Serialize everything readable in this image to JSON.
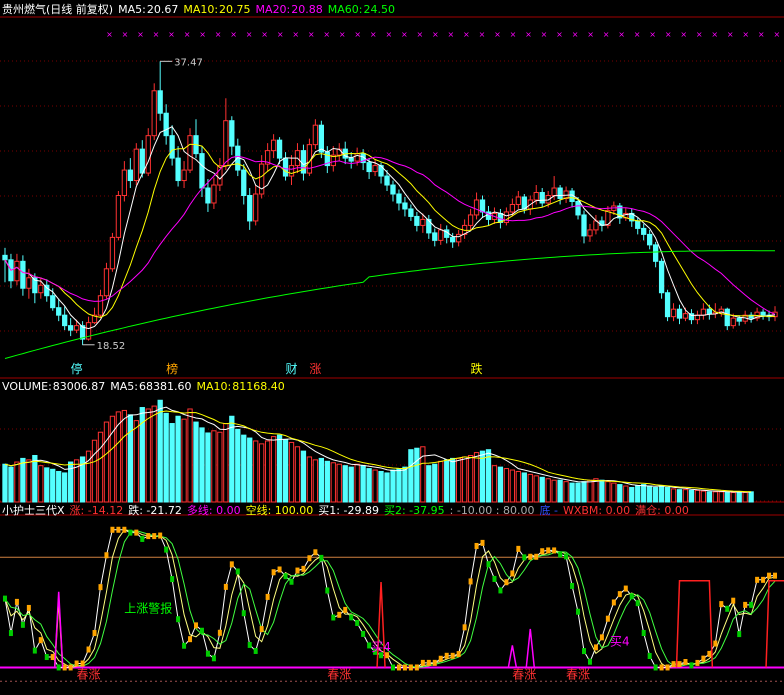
{
  "colors": {
    "bg": "#000000",
    "up": "#ff3232",
    "down": "#54ffff",
    "grid": "#7a0000",
    "ma5": "#ffffff",
    "ma10": "#ffff00",
    "ma20": "#ff00ff",
    "ma60": "#00ff00",
    "sep": "#a00000",
    "orange": "#ffa500",
    "green": "#00cc00",
    "red": "#ff2020",
    "magenta": "#ff00ff",
    "blue": "#3050ff"
  },
  "price_panel": {
    "title": "贵州燃气(日线 前复权)",
    "ma5": {
      "label": "MA5:",
      "value": "20.67"
    },
    "ma10": {
      "label": "MA10:",
      "value": "20.75"
    },
    "ma20": {
      "label": "MA20:",
      "value": "20.88"
    },
    "ma60": {
      "label": "MA60:",
      "value": "24.50"
    },
    "high_label": "37.47",
    "low_label": "18.52",
    "markers": [
      {
        "text": "停",
        "color": "#54ffff"
      },
      {
        "text": "榜",
        "color": "#ffa500"
      },
      {
        "text": "财",
        "color": "#54ffff"
      },
      {
        "text": "涨",
        "color": "#ff3232"
      },
      {
        "text": "跌",
        "color": "#ffff00"
      }
    ]
  },
  "volume_panel": {
    "volume": {
      "label": "VOLUME:",
      "value": "83006.87"
    },
    "ma5": {
      "label": "MA5:",
      "value": "68381.60"
    },
    "ma10": {
      "label": "MA10:",
      "value": "81168.40"
    }
  },
  "indicator_panel": {
    "name": "小护士三代X",
    "items": [
      {
        "label": "涨:",
        "value": "-14.12",
        "color": "#ff3232"
      },
      {
        "label": "跌:",
        "value": "-21.72",
        "color": "#ffffff"
      },
      {
        "label": "多线:",
        "value": "0.00",
        "color": "#ff00ff"
      },
      {
        "label": "空线:",
        "value": "100.00",
        "color": "#ffff00"
      },
      {
        "label": "买1:",
        "value": "-29.89",
        "color": "#ffffff"
      },
      {
        "label": "买2:",
        "value": "-37.95",
        "color": "#00ff00"
      },
      {
        "label": ":",
        "value": "-10.00 : 80.00",
        "color": "#aaaaaa"
      },
      {
        "label": "底",
        "value": "-",
        "color": "#3050ff"
      },
      {
        "label": "WXBM:",
        "value": "0.00",
        "color": "#ff3232"
      },
      {
        "label": "满仓:",
        "value": "0.00",
        "color": "#ff3232"
      }
    ],
    "signals": [
      {
        "text": "春涨",
        "color": "#ff3232"
      },
      {
        "text": "上涨警报",
        "color": "#00ff00"
      },
      {
        "text": "春涨",
        "color": "#ff3232"
      },
      {
        "text": "买4",
        "color": "#ff00ff"
      },
      {
        "text": "春涨",
        "color": "#ff3232"
      },
      {
        "text": "春涨",
        "color": "#ff3232"
      },
      {
        "text": "买4",
        "color": "#ff00ff"
      }
    ]
  },
  "chart_data": {
    "type": "candlestick",
    "price_ylim": [
      16.5,
      40.5
    ],
    "candles": [
      [
        24.5,
        24.2,
        25.0,
        22.7
      ],
      [
        24.2,
        22.8,
        24.6,
        22.3
      ],
      [
        22.8,
        24.1,
        24.6,
        22.5
      ],
      [
        24.1,
        22.3,
        24.5,
        21.8
      ],
      [
        22.3,
        23.0,
        23.6,
        21.6
      ],
      [
        23.0,
        22.0,
        23.3,
        21.3
      ],
      [
        22.0,
        22.5,
        23.0,
        21.6
      ],
      [
        22.5,
        21.8,
        22.9,
        21.4
      ],
      [
        21.8,
        21.0,
        22.3,
        20.8
      ],
      [
        21.0,
        20.5,
        21.6,
        20.1
      ],
      [
        20.5,
        19.8,
        21.1,
        19.5
      ],
      [
        19.8,
        19.5,
        20.3,
        19.1
      ],
      [
        19.5,
        19.8,
        20.2,
        19.3
      ],
      [
        19.8,
        18.9,
        20.1,
        18.5
      ],
      [
        18.9,
        20.0,
        20.4,
        18.8
      ],
      [
        20.0,
        20.5,
        21.0,
        19.9
      ],
      [
        20.5,
        21.8,
        22.2,
        20.3
      ],
      [
        21.8,
        23.6,
        24.0,
        21.6
      ],
      [
        23.6,
        25.7,
        26.0,
        23.4
      ],
      [
        25.7,
        28.5,
        28.8,
        25.5
      ],
      [
        28.5,
        30.2,
        30.8,
        28.1
      ],
      [
        30.2,
        29.5,
        31.0,
        29.0
      ],
      [
        29.5,
        31.6,
        32.0,
        29.2
      ],
      [
        31.6,
        30.0,
        32.2,
        29.7
      ],
      [
        30.0,
        32.5,
        33.0,
        29.8
      ],
      [
        32.5,
        35.5,
        36.0,
        32.2
      ],
      [
        35.5,
        34.0,
        37.47,
        33.5
      ],
      [
        34.0,
        32.5,
        34.6,
        31.9
      ],
      [
        32.5,
        31.0,
        33.2,
        30.5
      ],
      [
        31.0,
        29.5,
        31.8,
        29.1
      ],
      [
        29.5,
        30.2,
        30.8,
        29.0
      ],
      [
        30.2,
        32.5,
        33.0,
        30.0
      ],
      [
        32.5,
        31.3,
        33.6,
        31.0
      ],
      [
        31.3,
        29.0,
        31.8,
        28.4
      ],
      [
        29.0,
        28.0,
        29.6,
        27.4
      ],
      [
        28.0,
        29.2,
        29.7,
        27.6
      ],
      [
        29.2,
        30.5,
        31.0,
        28.8
      ],
      [
        30.5,
        33.5,
        35.0,
        30.2
      ],
      [
        33.5,
        31.8,
        33.8,
        31.2
      ],
      [
        31.8,
        30.2,
        32.3,
        29.8
      ],
      [
        30.2,
        28.5,
        30.6,
        27.9
      ],
      [
        28.5,
        26.8,
        29.0,
        26.2
      ],
      [
        26.8,
        28.6,
        29.2,
        26.5
      ],
      [
        28.6,
        30.6,
        31.2,
        28.3
      ],
      [
        30.6,
        31.5,
        32.0,
        30.1
      ],
      [
        31.5,
        32.2,
        32.6,
        31.0
      ],
      [
        32.2,
        31.0,
        32.4,
        30.6
      ],
      [
        31.0,
        29.8,
        31.4,
        29.5
      ],
      [
        29.8,
        30.5,
        31.2,
        29.2
      ],
      [
        30.5,
        31.5,
        32.0,
        30.0
      ],
      [
        31.5,
        30.0,
        31.9,
        29.5
      ],
      [
        30.0,
        31.9,
        32.3,
        29.8
      ],
      [
        31.9,
        33.2,
        33.6,
        31.6
      ],
      [
        33.2,
        31.4,
        33.5,
        31.0
      ],
      [
        31.4,
        30.5,
        31.8,
        30.0
      ],
      [
        30.5,
        31.2,
        31.8,
        30.1
      ],
      [
        31.2,
        31.6,
        32.0,
        30.8
      ],
      [
        31.6,
        31.0,
        32.1,
        30.6
      ],
      [
        31.0,
        30.8,
        31.4,
        30.3
      ],
      [
        30.8,
        31.3,
        31.7,
        30.5
      ],
      [
        31.3,
        30.7,
        31.6,
        30.2
      ],
      [
        30.7,
        30.1,
        31.0,
        29.6
      ],
      [
        30.1,
        30.5,
        30.9,
        29.8
      ],
      [
        30.5,
        29.8,
        30.7,
        29.3
      ],
      [
        29.8,
        29.2,
        30.2,
        28.8
      ],
      [
        29.2,
        28.6,
        29.5,
        28.1
      ],
      [
        28.6,
        28.0,
        28.9,
        27.5
      ],
      [
        28.0,
        27.6,
        28.4,
        27.1
      ],
      [
        27.6,
        27.1,
        27.9,
        26.8
      ],
      [
        27.1,
        26.5,
        27.4,
        26.1
      ],
      [
        26.5,
        26.9,
        27.3,
        26.0
      ],
      [
        26.9,
        26.0,
        27.2,
        25.6
      ],
      [
        26.0,
        25.5,
        26.3,
        25.1
      ],
      [
        25.5,
        26.2,
        26.6,
        25.2
      ],
      [
        26.2,
        25.7,
        26.5,
        25.3
      ],
      [
        25.7,
        25.4,
        26.0,
        25.0
      ],
      [
        25.4,
        25.9,
        26.2,
        25.1
      ],
      [
        25.9,
        26.5,
        26.9,
        25.6
      ],
      [
        26.5,
        27.2,
        27.6,
        26.2
      ],
      [
        27.2,
        28.2,
        28.7,
        26.9
      ],
      [
        28.2,
        27.4,
        28.5,
        27.0
      ],
      [
        27.4,
        26.9,
        27.8,
        26.5
      ],
      [
        26.9,
        27.3,
        27.7,
        26.6
      ],
      [
        27.3,
        26.7,
        27.6,
        26.3
      ],
      [
        26.7,
        27.4,
        27.7,
        26.5
      ],
      [
        27.4,
        27.9,
        28.3,
        27.1
      ],
      [
        27.9,
        28.4,
        28.8,
        27.6
      ],
      [
        28.4,
        27.6,
        28.6,
        27.3
      ],
      [
        27.6,
        28.2,
        28.5,
        27.2
      ],
      [
        28.2,
        28.7,
        29.2,
        27.9
      ],
      [
        28.7,
        28.0,
        29.0,
        27.7
      ],
      [
        28.0,
        28.5,
        28.8,
        27.7
      ],
      [
        28.5,
        29.0,
        29.8,
        28.2
      ],
      [
        29.0,
        28.3,
        29.2,
        27.9
      ],
      [
        28.3,
        28.8,
        29.1,
        28.0
      ],
      [
        28.8,
        28.1,
        29.0,
        27.7
      ],
      [
        28.1,
        27.2,
        28.4,
        26.9
      ],
      [
        27.2,
        25.8,
        27.5,
        25.3
      ],
      [
        25.8,
        26.2,
        26.6,
        25.4
      ],
      [
        26.2,
        26.8,
        27.2,
        25.9
      ],
      [
        26.8,
        26.5,
        27.1,
        26.1
      ],
      [
        26.5,
        27.5,
        27.8,
        26.3
      ],
      [
        27.5,
        27.8,
        28.1,
        27.2
      ],
      [
        27.8,
        27.0,
        28.0,
        26.6
      ],
      [
        27.0,
        27.3,
        27.7,
        26.8
      ],
      [
        27.3,
        26.8,
        27.6,
        26.4
      ],
      [
        26.8,
        26.3,
        27.0,
        25.9
      ],
      [
        26.3,
        25.9,
        26.6,
        25.5
      ],
      [
        25.9,
        25.2,
        26.2,
        24.9
      ],
      [
        25.2,
        24.1,
        25.4,
        23.7
      ],
      [
        24.1,
        22.0,
        24.3,
        21.6
      ],
      [
        22.0,
        20.4,
        22.2,
        20.1
      ],
      [
        20.4,
        20.9,
        21.3,
        20.1
      ],
      [
        20.9,
        20.3,
        21.2,
        19.9
      ],
      [
        20.3,
        20.6,
        21.0,
        20.1
      ],
      [
        20.6,
        20.2,
        20.9,
        19.9
      ],
      [
        20.2,
        20.5,
        20.8,
        19.9
      ],
      [
        20.5,
        20.9,
        21.3,
        20.2
      ],
      [
        20.9,
        20.6,
        21.2,
        20.2
      ],
      [
        20.6,
        20.7,
        21.3,
        20.3
      ],
      [
        20.7,
        20.9,
        21.1,
        20.4
      ],
      [
        20.9,
        19.8,
        21.0,
        19.5
      ],
      [
        19.8,
        20.3,
        20.6,
        19.6
      ],
      [
        20.3,
        20.1,
        20.5,
        19.8
      ],
      [
        20.1,
        20.5,
        20.8,
        19.9
      ],
      [
        20.5,
        20.3,
        20.7,
        20.0
      ],
      [
        20.3,
        20.7,
        21.0,
        20.1
      ],
      [
        20.7,
        20.5,
        20.9,
        20.2
      ],
      [
        20.5,
        20.4,
        20.8,
        20.1
      ],
      [
        20.4,
        20.7,
        21.1,
        20.1
      ]
    ],
    "volumes": [
      52,
      48,
      55,
      60,
      58,
      64,
      50,
      47,
      45,
      42,
      40,
      55,
      58,
      62,
      70,
      85,
      96,
      110,
      118,
      124,
      126,
      120,
      112,
      130,
      128,
      132,
      140,
      122,
      108,
      118,
      114,
      128,
      110,
      102,
      95,
      98,
      96,
      108,
      118,
      100,
      92,
      88,
      84,
      80,
      84,
      90,
      92,
      86,
      82,
      76,
      70,
      62,
      58,
      60,
      56,
      54,
      52,
      50,
      48,
      52,
      50,
      46,
      44,
      42,
      40,
      44,
      46,
      48,
      72,
      74,
      76,
      50,
      52,
      56,
      58,
      60,
      60,
      62,
      64,
      68,
      70,
      72,
      50,
      48,
      46,
      44,
      42,
      40,
      38,
      36,
      34,
      32,
      30,
      30,
      28,
      26,
      26,
      28,
      30,
      32,
      30,
      28,
      26,
      24,
      22,
      20,
      22,
      24,
      22,
      20,
      22,
      20,
      18,
      17,
      17,
      16,
      16,
      15,
      14,
      14,
      14,
      14,
      13,
      14,
      13,
      14
    ],
    "volume_ylim": [
      0,
      150
    ],
    "indicator_ylim": [
      -20,
      110
    ]
  }
}
